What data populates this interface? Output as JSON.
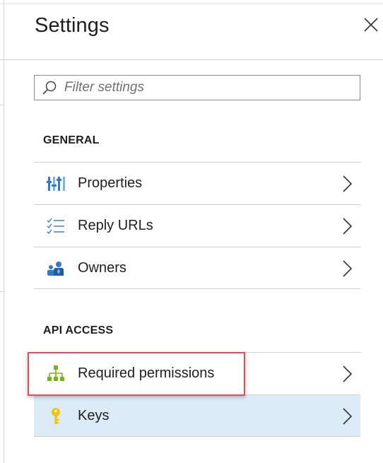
{
  "panel": {
    "title": "Settings",
    "close_icon": "close-icon"
  },
  "filter": {
    "placeholder": "Filter settings",
    "value": "",
    "icon": "search-icon"
  },
  "sections": {
    "general": {
      "header": "GENERAL",
      "items": [
        {
          "label": "Properties",
          "icon": "properties-icon"
        },
        {
          "label": "Reply URLs",
          "icon": "checklist-icon"
        },
        {
          "label": "Owners",
          "icon": "owners-icon"
        }
      ]
    },
    "api_access": {
      "header": "API ACCESS",
      "items": [
        {
          "label": "Required permissions",
          "icon": "permissions-hierarchy-icon"
        },
        {
          "label": "Keys",
          "icon": "key-icon",
          "selected": true
        }
      ]
    }
  },
  "colors": {
    "selected_row": "#dcebf8",
    "highlight_border": "#d9534f",
    "icon_blue": "#2f7bc7",
    "icon_green": "#7ab317",
    "icon_yellow": "#f5c400"
  }
}
